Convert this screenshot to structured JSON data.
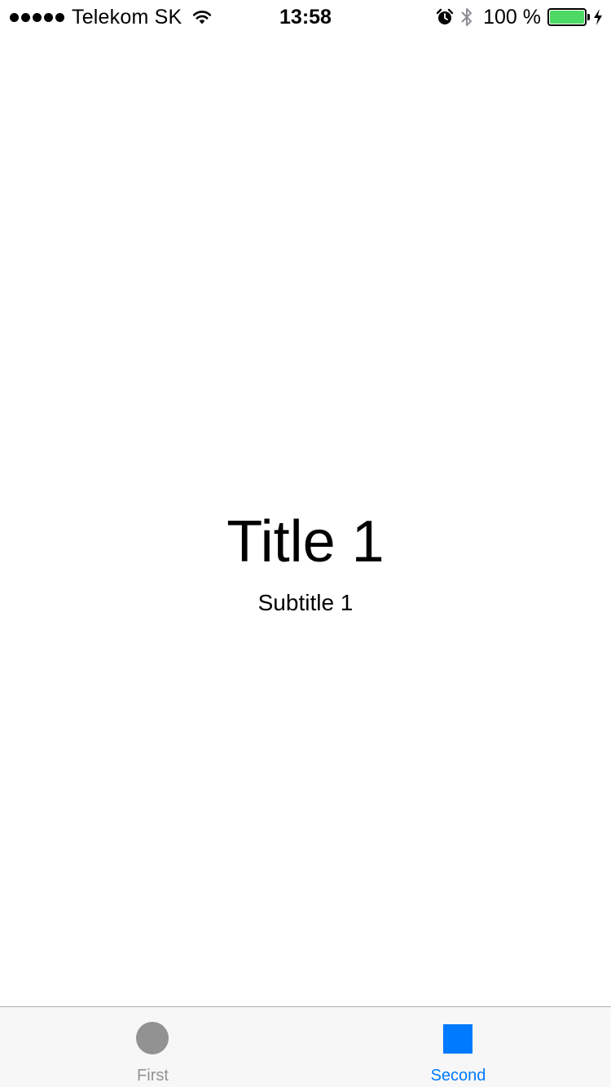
{
  "status_bar": {
    "carrier": "Telekom SK",
    "time": "13:58",
    "battery_percent_text": "100 %",
    "battery_level": 1.0,
    "battery_color": "#4cd964",
    "icons": [
      "signal-dots-icon",
      "wifi-icon",
      "alarm-icon",
      "bluetooth-icon",
      "battery-icon",
      "charging-bolt-icon"
    ]
  },
  "main": {
    "title": "Title 1",
    "subtitle": "Subtitle 1"
  },
  "tab_bar": {
    "selected_color": "#007aff",
    "unselected_color": "#929292",
    "tabs": [
      {
        "label": "First",
        "icon": "circle-icon",
        "selected": false
      },
      {
        "label": "Second",
        "icon": "square-icon",
        "selected": true
      }
    ]
  }
}
